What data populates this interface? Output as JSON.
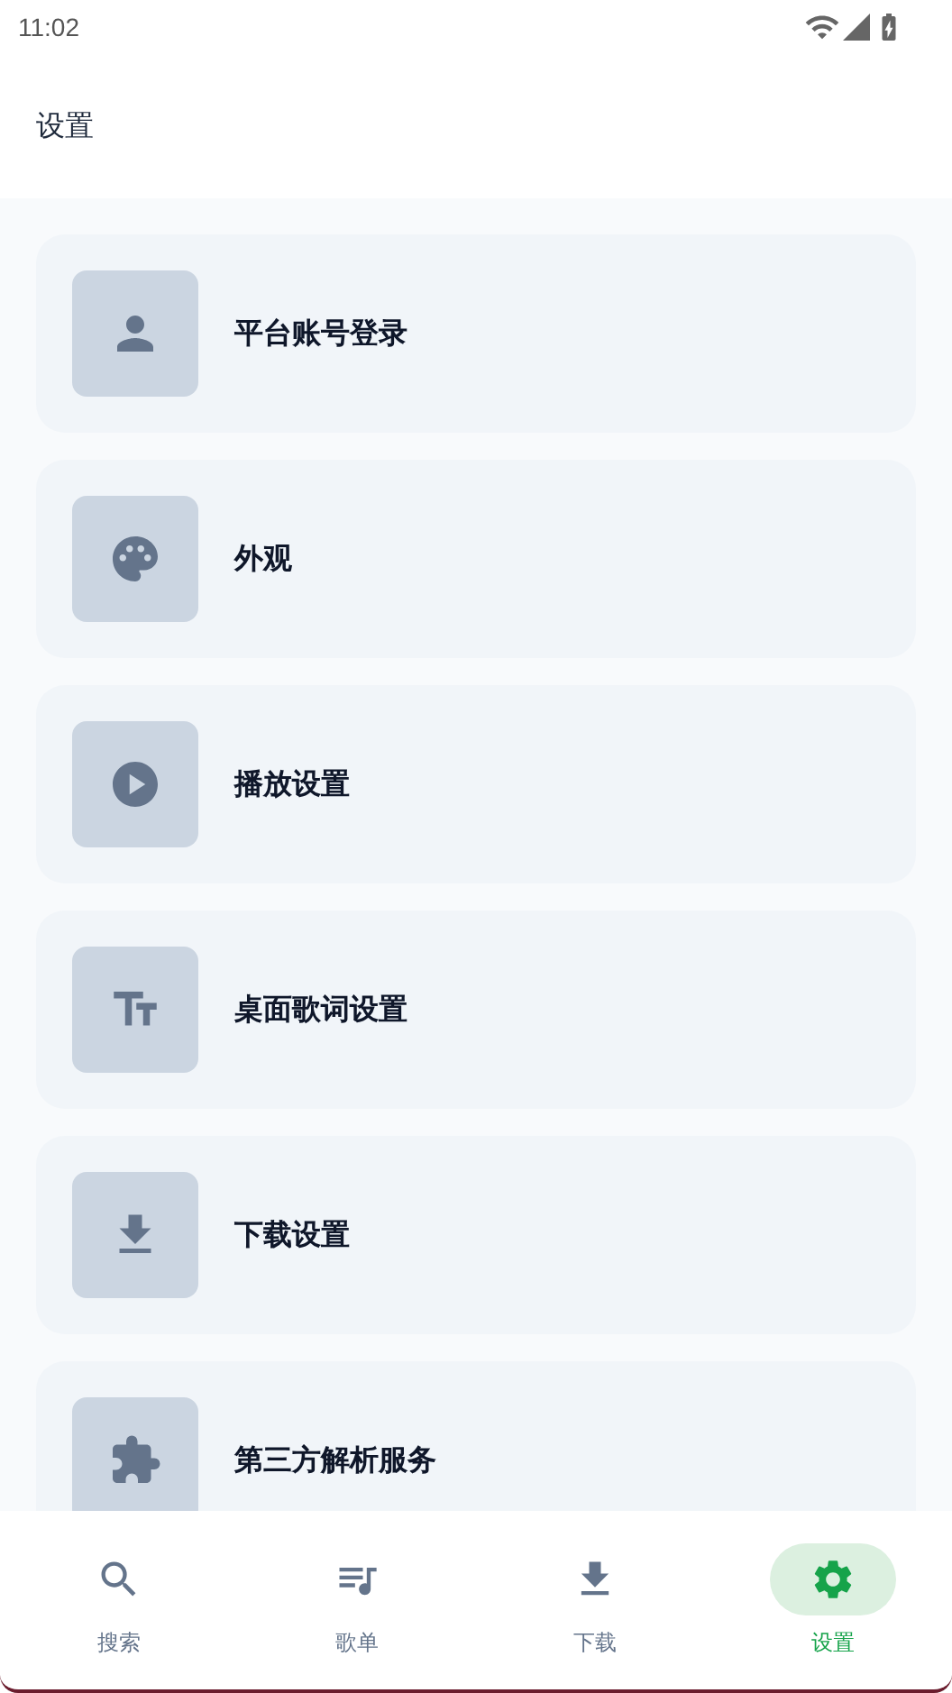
{
  "status_bar": {
    "time": "11:02"
  },
  "header": {
    "title": "设置"
  },
  "settings": [
    {
      "kind": "account",
      "label": "平台账号登录"
    },
    {
      "kind": "appearance",
      "label": "外观"
    },
    {
      "kind": "playback",
      "label": "播放设置"
    },
    {
      "kind": "lyrics",
      "label": "桌面歌词设置"
    },
    {
      "kind": "download",
      "label": "下载设置"
    },
    {
      "kind": "plugin",
      "label": "第三方解析服务"
    }
  ],
  "nav": [
    {
      "kind": "search",
      "label": "搜索",
      "selected": false
    },
    {
      "kind": "playlist",
      "label": "歌单",
      "selected": false
    },
    {
      "kind": "download",
      "label": "下载",
      "selected": false
    },
    {
      "kind": "settings",
      "label": "设置",
      "selected": true
    }
  ]
}
